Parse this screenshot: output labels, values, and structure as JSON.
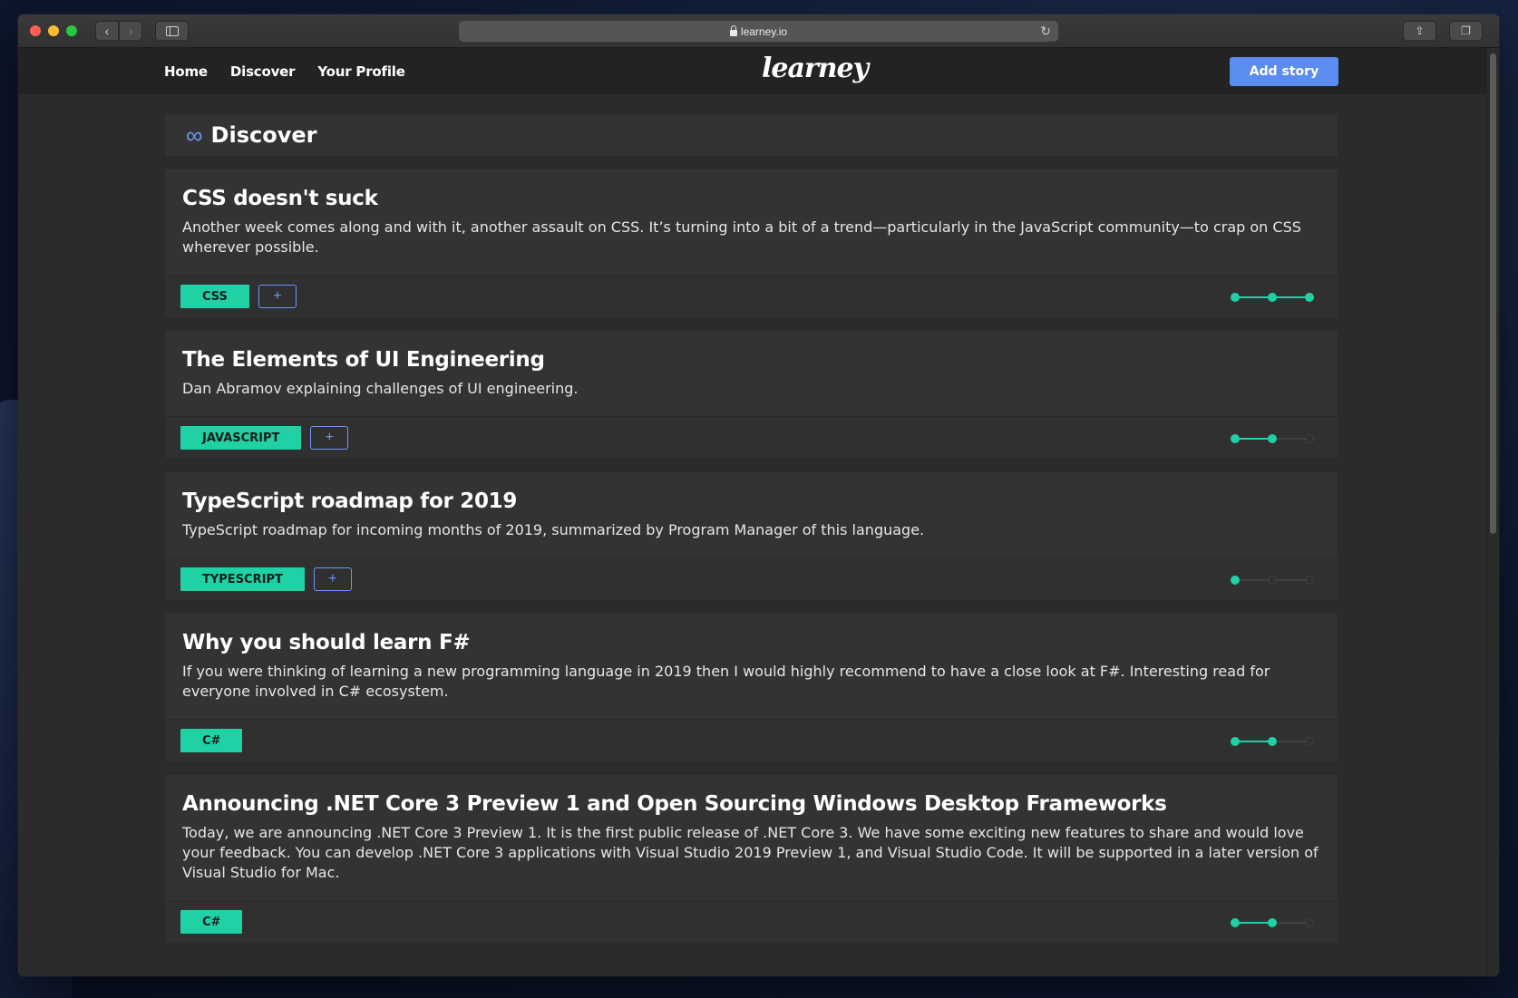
{
  "browser": {
    "url": "learney.io"
  },
  "app": {
    "nav": [
      "Home",
      "Discover",
      "Your Profile"
    ],
    "logo": "learney",
    "add_story_label": "Add story",
    "section_title": "Discover",
    "accent": "#1fd1a5",
    "primary": "#5b8cf0"
  },
  "stories": [
    {
      "title": "CSS doesn't suck",
      "desc": "Another week comes along and with it, another assault on CSS. It’s turning into a bit of a trend—particularly in the JavaScript community—to crap on CSS wherever possible.",
      "tag": "CSS",
      "show_add": true,
      "progress": 3
    },
    {
      "title": "The Elements of UI Engineering",
      "desc": "Dan Abramov explaining challenges of UI engineering.",
      "tag": "JAVASCRIPT",
      "show_add": true,
      "progress": 2
    },
    {
      "title": "TypeScript roadmap for 2019",
      "desc": "TypeScript roadmap for incoming months of 2019, summarized by Program Manager of this language.",
      "tag": "TYPESCRIPT",
      "show_add": true,
      "progress": 1
    },
    {
      "title": "Why you should learn F#",
      "desc": "If you were thinking of learning a new programming language in 2019 then I would highly recommend to have a close look at F#. Interesting read for everyone involved in C# ecosystem.",
      "tag": "C#",
      "show_add": false,
      "progress": 2
    },
    {
      "title": "Announcing .NET Core 3 Preview 1 and Open Sourcing Windows Desktop Frameworks",
      "desc": "Today, we are announcing .NET Core 3 Preview 1. It is the first public release of .NET Core 3. We have some exciting new features to share and would love your feedback. You can develop .NET Core 3 applications with Visual Studio 2019 Preview 1, and Visual Studio Code. It will be supported in a later version of Visual Studio for Mac.",
      "tag": "C#",
      "show_add": false,
      "progress": 2
    }
  ]
}
